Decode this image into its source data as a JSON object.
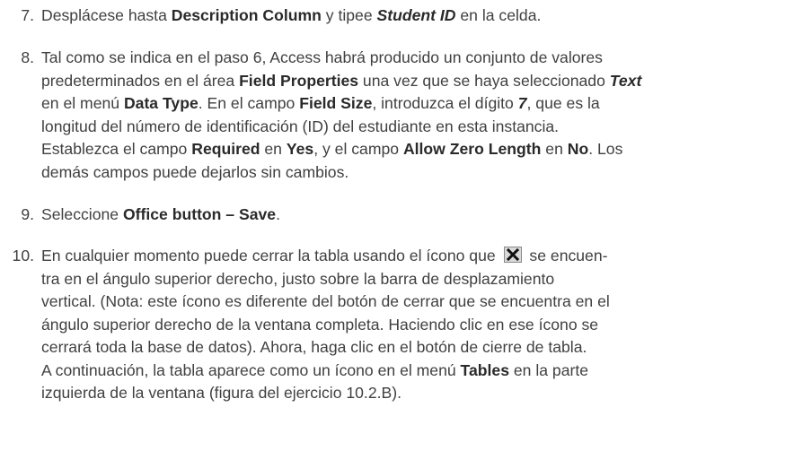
{
  "steps": [
    {
      "number": "7.",
      "lines": [
        [
          {
            "t": "Desplácese hasta "
          },
          {
            "t": "Description Column",
            "b": true
          },
          {
            "t": " y tipee "
          },
          {
            "t": "Student ID",
            "b": true,
            "i": true
          },
          {
            "t": " en la celda."
          }
        ]
      ]
    },
    {
      "number": "8.",
      "lines": [
        [
          {
            "t": "Tal como se indica en el paso 6, Access habrá producido un conjunto de valores"
          }
        ],
        [
          {
            "t": "predeterminados en el área "
          },
          {
            "t": "Field Properties",
            "b": true
          },
          {
            "t": " una vez que se haya seleccionado "
          },
          {
            "t": "Text",
            "b": true,
            "i": true
          }
        ],
        [
          {
            "t": "en el menú "
          },
          {
            "t": "Data Type",
            "b": true
          },
          {
            "t": ". En el campo "
          },
          {
            "t": "Field Size",
            "b": true
          },
          {
            "t": ", introduzca el dígito "
          },
          {
            "t": "7",
            "b": true,
            "i": true
          },
          {
            "t": ", que es la"
          }
        ],
        [
          {
            "t": "longitud del número de identificación (ID) del estudiante en esta instancia."
          }
        ],
        [
          {
            "t": "Establezca el campo "
          },
          {
            "t": "Required",
            "b": true
          },
          {
            "t": " en "
          },
          {
            "t": "Yes",
            "b": true
          },
          {
            "t": ", y el campo "
          },
          {
            "t": "Allow Zero Length",
            "b": true
          },
          {
            "t": " en "
          },
          {
            "t": "No",
            "b": true
          },
          {
            "t": ". Los"
          }
        ],
        [
          {
            "t": "demás campos puede dejarlos sin cambios."
          }
        ]
      ]
    },
    {
      "number": "9.",
      "lines": [
        [
          {
            "t": "Seleccione "
          },
          {
            "t": "Office button – Save",
            "b": true
          },
          {
            "t": "."
          }
        ]
      ]
    },
    {
      "number": "10.",
      "lines": [
        [
          {
            "t": "En cualquier momento puede cerrar la tabla usando el ícono que "
          },
          {
            "icon": "close-icon"
          },
          {
            "t": " se encuen-"
          }
        ],
        [
          {
            "t": "tra en el ángulo superior derecho, justo sobre la barra de desplazamiento"
          }
        ],
        [
          {
            "t": "vertical. (Nota: este ícono es diferente del botón de cerrar que se encuentra en el"
          }
        ],
        [
          {
            "t": "ángulo superior derecho de la ventana completa. Haciendo clic en ese ícono se"
          }
        ],
        [
          {
            "t": "cerrará toda la base de datos). Ahora, haga clic en el botón de cierre de tabla."
          }
        ],
        [
          {
            "t": "A continuación, la tabla aparece como un ícono en el menú "
          },
          {
            "t": "Tables",
            "b": true
          },
          {
            "t": " en la parte"
          }
        ],
        [
          {
            "t": "izquierda de la ventana (figura del ejercicio 10.2.B)."
          }
        ]
      ]
    }
  ]
}
